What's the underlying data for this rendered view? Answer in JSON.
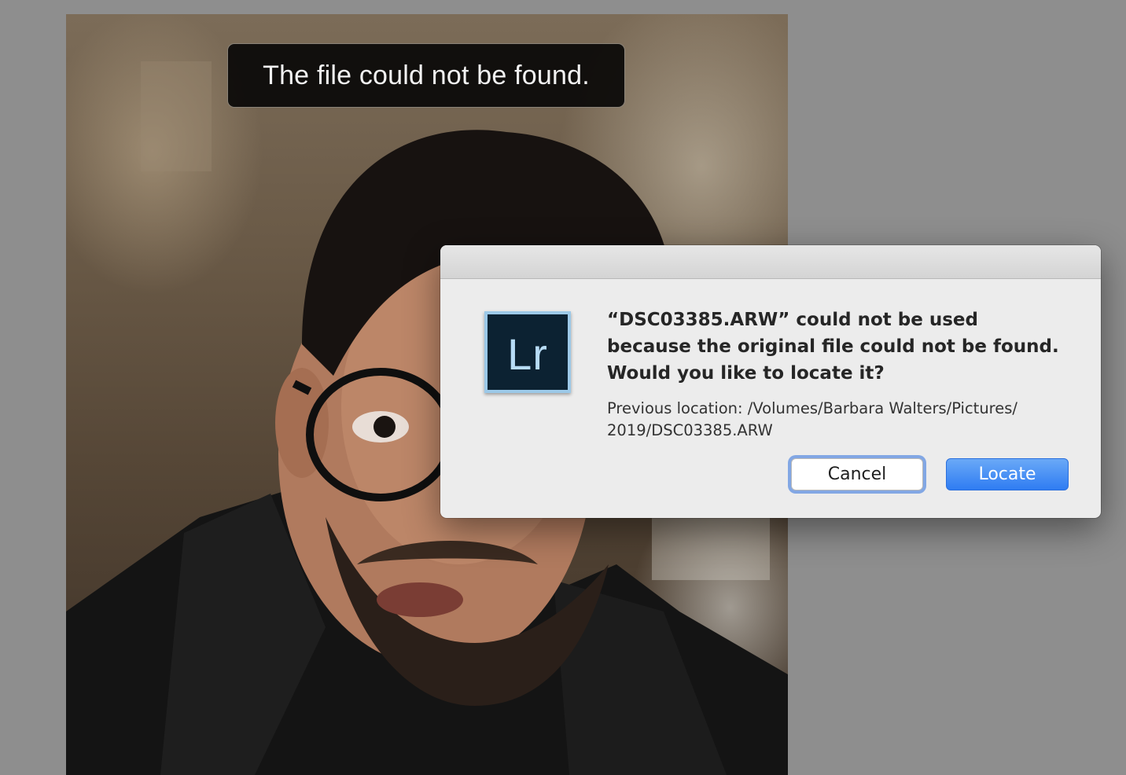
{
  "hud": {
    "message": "The file could not be found."
  },
  "dialog": {
    "app_icon_text": "Lr",
    "message_lines": [
      "“DSC03385.ARW” could not be used",
      "because the original file could not be found.",
      "Would you like to locate it?"
    ],
    "info_lines": [
      "Previous location: /Volumes/Barbara Walters/Pictures/",
      "2019/DSC03385.ARW"
    ],
    "buttons": {
      "cancel_label": "Cancel",
      "locate_label": "Locate"
    }
  },
  "colors": {
    "desktop_bg": "#8e8e8e",
    "dialog_bg": "#ececec",
    "accent_blue": "#2f7cf2",
    "focus_ring": "#82a7e4",
    "lr_icon_bg": "#0c2232",
    "lr_icon_text": "#b7dcf6"
  }
}
